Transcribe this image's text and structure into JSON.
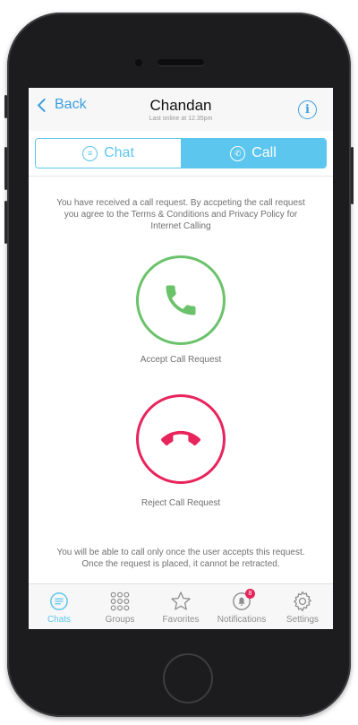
{
  "nav": {
    "back_label": "Back",
    "title": "Chandan",
    "subtitle": "Last online at 12.35pm",
    "info_glyph": "i"
  },
  "tabs": [
    {
      "label": "Chat",
      "icon": "chat-bubble-icon",
      "selected": false
    },
    {
      "label": "Call",
      "icon": "phone-icon",
      "selected": true
    }
  ],
  "notice_top": "You have received a call request. By accpeting the call request you agree to the Terms & Conditions and Privacy Policy for Internet Calling",
  "accept": {
    "label": "Accept Call Request",
    "icon": "phone-accept-icon",
    "color": "#6ac26a"
  },
  "reject": {
    "label": "Reject Call Request",
    "icon": "phone-hangup-icon",
    "color": "#e8245c"
  },
  "notice_bottom": "You will be able to call only once the user accepts this request. Once the request is placed, it cannot be retracted.",
  "tabbar": [
    {
      "label": "Chats",
      "icon": "chat-bubble-icon",
      "active": true
    },
    {
      "label": "Groups",
      "icon": "grid-icon",
      "active": false
    },
    {
      "label": "Favorites",
      "icon": "star-icon",
      "active": false
    },
    {
      "label": "Notifications",
      "icon": "bell-icon",
      "active": false,
      "badge": "8"
    },
    {
      "label": "Settings",
      "icon": "gear-icon",
      "active": false
    }
  ],
  "colors": {
    "accent": "#5cc6ee",
    "link": "#3a9fe0",
    "accept": "#6ac26a",
    "reject": "#e8245c",
    "muted_text": "#707070"
  }
}
